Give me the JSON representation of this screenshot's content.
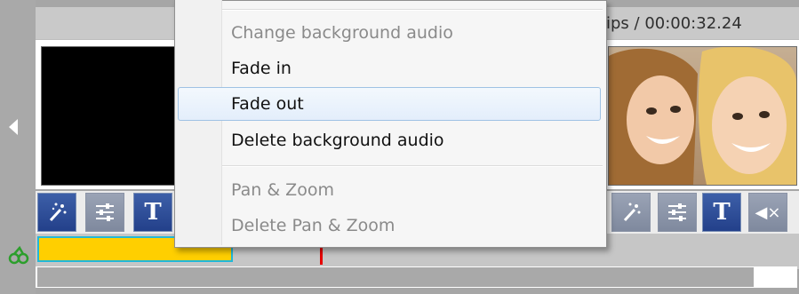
{
  "timeline_header": {
    "timecode": "ips / 00:00:32.24"
  },
  "context_menu": {
    "items": [
      {
        "label": "Change background audio",
        "enabled": false
      },
      {
        "label": "Fade in",
        "enabled": true
      },
      {
        "label": "Fade out",
        "enabled": true,
        "highlighted": true
      },
      {
        "label": "Delete background audio",
        "enabled": true
      },
      {
        "label": "Pan & Zoom",
        "enabled": false
      },
      {
        "label": "Delete Pan & Zoom",
        "enabled": false
      }
    ]
  },
  "clip_toolbar": {
    "text_button_label": "T",
    "mute_icon_label": "◀×"
  },
  "colors": {
    "accent_blue": "#23408a",
    "audio_track": "#ffcf00",
    "playhead": "#e60000",
    "menu_highlight": "#9fc2e4"
  }
}
